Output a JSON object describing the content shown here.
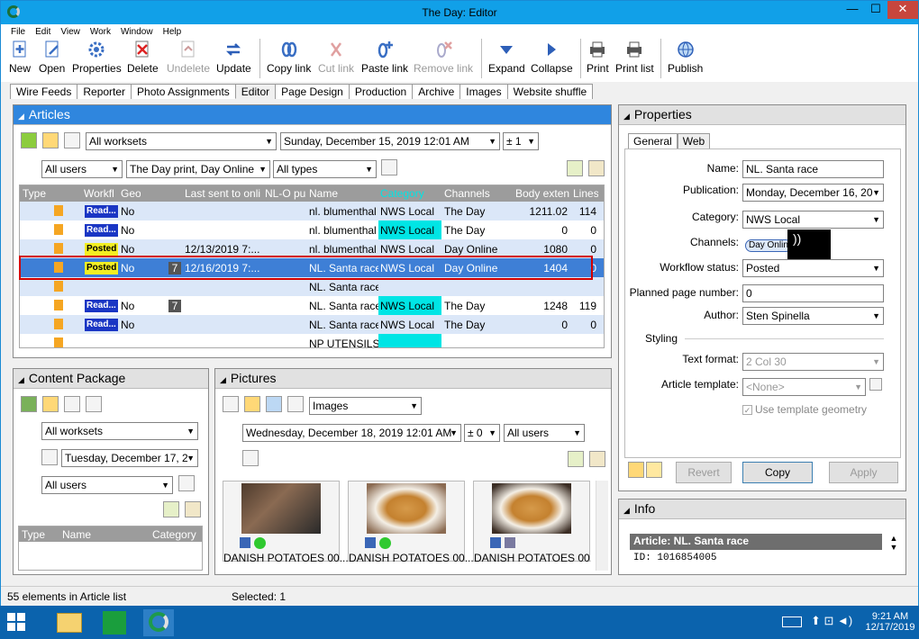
{
  "window": {
    "title": "The Day: Editor",
    "min": "—",
    "max": "☐",
    "close": "✕"
  },
  "menu": [
    "File",
    "Edit",
    "View",
    "Work",
    "Window",
    "Help"
  ],
  "toolbar": {
    "new": "New",
    "open": "Open",
    "properties": "Properties",
    "delete": "Delete",
    "undelete": "Undelete",
    "update": "Update",
    "copy_link": "Copy link",
    "cut_link": "Cut link",
    "paste_link": "Paste link",
    "remove_link": "Remove link",
    "expand": "Expand",
    "collapse": "Collapse",
    "print": "Print",
    "print_list": "Print list",
    "publish": "Publish"
  },
  "tabs": [
    "Wire Feeds",
    "Reporter",
    "Photo Assignments",
    "Editor",
    "Page Design",
    "Production",
    "Archive",
    "Images",
    "Website shuffle"
  ],
  "articles": {
    "title": "Articles",
    "workset": "All worksets",
    "date": "Sunday, December 15, 2019 12:01 AM",
    "range": "± 1",
    "users": "All users",
    "publication": "The Day print, Day Online",
    "types": "All types",
    "columns": [
      "Type",
      "Workfl",
      "Geo",
      "",
      "",
      "Last sent to onli",
      "NL-O pu",
      "Name",
      "Category",
      "Channels",
      "",
      "Body exten",
      "Lines"
    ],
    "rows": [
      {
        "status": "Read...",
        "geo": "No",
        "count": "",
        "sent": "",
        "name": "nl. blumenthal",
        "category": "NWS Local",
        "channel": "The Day",
        "body": "1211.02",
        "lines": "114"
      },
      {
        "status": "Read...",
        "geo": "No",
        "count": "",
        "sent": "",
        "name": "nl. blumenthal",
        "category": "NWS Local",
        "channel": "The Day",
        "body": "0",
        "lines": "0"
      },
      {
        "status": "Posted",
        "geo": "No",
        "count": "",
        "sent": "12/13/2019 7:...",
        "name": "nl. blumenthal",
        "category": "NWS Local",
        "channel": "Day Online",
        "body": "1080",
        "lines": "0"
      },
      {
        "status": "Posted",
        "geo": "No",
        "count": "7",
        "sent": "12/16/2019 7:...",
        "name": "NL. Santa race",
        "category": "NWS Local",
        "channel": "Day Online",
        "body": "1404",
        "lines": "0"
      },
      {
        "status": "",
        "geo": "",
        "count": "",
        "sent": "",
        "name": "NL. Santa race",
        "category": "",
        "channel": "",
        "body": "",
        "lines": ""
      },
      {
        "status": "Read...",
        "geo": "No",
        "count": "7",
        "sent": "",
        "name": "NL. Santa race",
        "category": "NWS Local",
        "channel": "The Day",
        "body": "1248",
        "lines": "119"
      },
      {
        "status": "Read...",
        "geo": "No",
        "count": "",
        "sent": "",
        "name": "NL. Santa race",
        "category": "NWS Local",
        "channel": "The Day",
        "body": "0",
        "lines": "0"
      },
      {
        "status": "",
        "geo": "",
        "count": "",
        "sent": "",
        "name": "NP UTENSILS",
        "category": "",
        "channel": "",
        "body": "",
        "lines": ""
      }
    ]
  },
  "content_package": {
    "title": "Content Package",
    "workset": "All worksets",
    "date": "Tuesday, December 17, 2",
    "users": "All users",
    "cols": [
      "Type",
      "Name",
      "Category"
    ]
  },
  "pictures": {
    "title": "Pictures",
    "source": "Images",
    "date": "Wednesday, December 18, 2019 12:01 AM",
    "range": "± 0",
    "users": "All users",
    "items": [
      "DANISH POTATOES 00...",
      "DANISH POTATOES 00...",
      "DANISH POTATOES 00..."
    ]
  },
  "properties": {
    "title": "Properties",
    "tabs": [
      "General",
      "Web"
    ],
    "name_label": "Name:",
    "name": "NL. Santa race",
    "publication_label": "Publication:",
    "publication": "Monday, December 16, 20",
    "category_label": "Category:",
    "category": "NWS Local",
    "channels_label": "Channels:",
    "channel_chip": "Day Onlin",
    "workflow_label": "Workflow status:",
    "workflow": "Posted",
    "page_label": "Planned page number:",
    "page": "0",
    "author_label": "Author:",
    "author": "Sten Spinella",
    "styling_label": "Styling",
    "format_label": "Text format:",
    "format": "2 Col 30",
    "template_label": "Article template:",
    "template": "<None>",
    "geometry_label": "Use template geometry",
    "revert": "Revert",
    "copy": "Copy",
    "apply": "Apply"
  },
  "info": {
    "title": "Info",
    "article": "Article: NL. Santa race",
    "id": "ID: 1016854005"
  },
  "status": {
    "count": "55 elements in Article list",
    "selected": "Selected: 1"
  },
  "clock": {
    "time": "9:21 AM",
    "date": "12/17/2019"
  }
}
